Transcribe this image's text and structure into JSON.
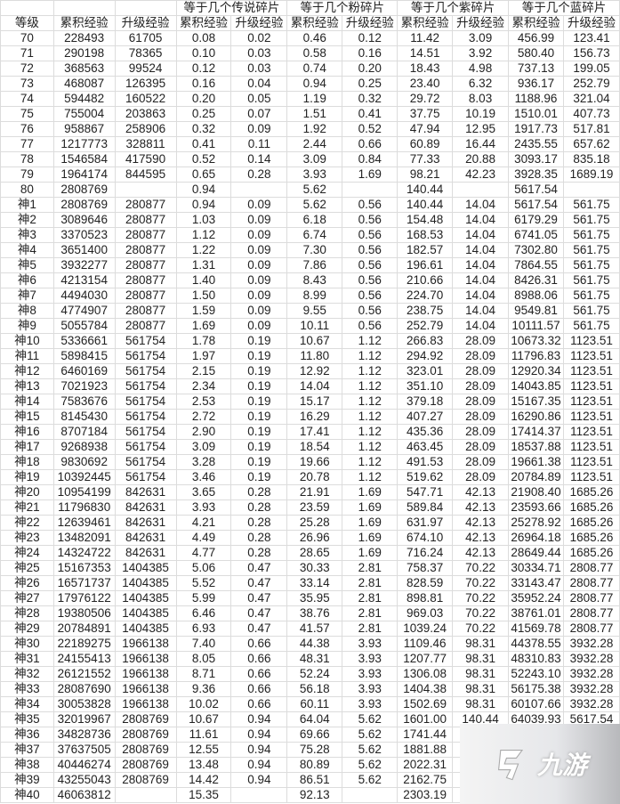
{
  "header": {
    "groups": [
      "等于几个传说碎片",
      "等于几个粉碎片",
      "等于几个紫碎片",
      "等于几个蓝碎片"
    ],
    "columns": [
      "等级",
      "累积经验",
      "升级经验",
      "累积经验",
      "升级经验",
      "累积经验",
      "升级经验",
      "累积经验",
      "升级经验",
      "累积经验",
      "升级经验"
    ]
  },
  "rows": [
    [
      "70",
      "228493",
      "61705",
      "0.08",
      "0.02",
      "0.46",
      "0.12",
      "11.42",
      "3.09",
      "456.99",
      "123.41"
    ],
    [
      "71",
      "290198",
      "78365",
      "0.10",
      "0.03",
      "0.58",
      "0.16",
      "14.51",
      "3.92",
      "580.40",
      "156.73"
    ],
    [
      "72",
      "368563",
      "99524",
      "0.12",
      "0.03",
      "0.74",
      "0.20",
      "18.43",
      "4.98",
      "737.13",
      "199.05"
    ],
    [
      "73",
      "468087",
      "126395",
      "0.16",
      "0.04",
      "0.94",
      "0.25",
      "23.40",
      "6.32",
      "936.17",
      "252.79"
    ],
    [
      "74",
      "594482",
      "160522",
      "0.20",
      "0.05",
      "1.19",
      "0.32",
      "29.72",
      "8.03",
      "1188.96",
      "321.04"
    ],
    [
      "75",
      "755004",
      "203863",
      "0.25",
      "0.07",
      "1.51",
      "0.41",
      "37.75",
      "10.19",
      "1510.01",
      "407.73"
    ],
    [
      "76",
      "958867",
      "258906",
      "0.32",
      "0.09",
      "1.92",
      "0.52",
      "47.94",
      "12.95",
      "1917.73",
      "517.81"
    ],
    [
      "77",
      "1217773",
      "328811",
      "0.41",
      "0.11",
      "2.44",
      "0.66",
      "60.89",
      "16.44",
      "2435.55",
      "657.62"
    ],
    [
      "78",
      "1546584",
      "417590",
      "0.52",
      "0.14",
      "3.09",
      "0.84",
      "77.33",
      "20.88",
      "3093.17",
      "835.18"
    ],
    [
      "79",
      "1964174",
      "844595",
      "0.65",
      "0.28",
      "3.93",
      "1.69",
      "98.21",
      "42.23",
      "3928.35",
      "1689.19"
    ],
    [
      "80",
      "2808769",
      "",
      "0.94",
      "",
      "5.62",
      "",
      "140.44",
      "",
      "5617.54",
      ""
    ],
    [
      "神1",
      "2808769",
      "280877",
      "0.94",
      "0.09",
      "5.62",
      "0.56",
      "140.44",
      "14.04",
      "5617.54",
      "561.75"
    ],
    [
      "神2",
      "3089646",
      "280877",
      "1.03",
      "0.09",
      "6.18",
      "0.56",
      "154.48",
      "14.04",
      "6179.29",
      "561.75"
    ],
    [
      "神3",
      "3370523",
      "280877",
      "1.12",
      "0.09",
      "6.74",
      "0.56",
      "168.53",
      "14.04",
      "6741.05",
      "561.75"
    ],
    [
      "神4",
      "3651400",
      "280877",
      "1.22",
      "0.09",
      "7.30",
      "0.56",
      "182.57",
      "14.04",
      "7302.80",
      "561.75"
    ],
    [
      "神5",
      "3932277",
      "280877",
      "1.31",
      "0.09",
      "7.86",
      "0.56",
      "196.61",
      "14.04",
      "7864.55",
      "561.75"
    ],
    [
      "神6",
      "4213154",
      "280877",
      "1.40",
      "0.09",
      "8.43",
      "0.56",
      "210.66",
      "14.04",
      "8426.31",
      "561.75"
    ],
    [
      "神7",
      "4494030",
      "280877",
      "1.50",
      "0.09",
      "8.99",
      "0.56",
      "224.70",
      "14.04",
      "8988.06",
      "561.75"
    ],
    [
      "神8",
      "4774907",
      "280877",
      "1.59",
      "0.09",
      "9.55",
      "0.56",
      "238.75",
      "14.04",
      "9549.81",
      "561.75"
    ],
    [
      "神9",
      "5055784",
      "280877",
      "1.69",
      "0.09",
      "10.11",
      "0.56",
      "252.79",
      "14.04",
      "10111.57",
      "561.75"
    ],
    [
      "神10",
      "5336661",
      "561754",
      "1.78",
      "0.19",
      "10.67",
      "1.12",
      "266.83",
      "28.09",
      "10673.32",
      "1123.51"
    ],
    [
      "神11",
      "5898415",
      "561754",
      "1.97",
      "0.19",
      "11.80",
      "1.12",
      "294.92",
      "28.09",
      "11796.83",
      "1123.51"
    ],
    [
      "神12",
      "6460169",
      "561754",
      "2.15",
      "0.19",
      "12.92",
      "1.12",
      "323.01",
      "28.09",
      "12920.34",
      "1123.51"
    ],
    [
      "神13",
      "7021923",
      "561754",
      "2.34",
      "0.19",
      "14.04",
      "1.12",
      "351.10",
      "28.09",
      "14043.85",
      "1123.51"
    ],
    [
      "神14",
      "7583676",
      "561754",
      "2.53",
      "0.19",
      "15.17",
      "1.12",
      "379.18",
      "28.09",
      "15167.35",
      "1123.51"
    ],
    [
      "神15",
      "8145430",
      "561754",
      "2.72",
      "0.19",
      "16.29",
      "1.12",
      "407.27",
      "28.09",
      "16290.86",
      "1123.51"
    ],
    [
      "神16",
      "8707184",
      "561754",
      "2.90",
      "0.19",
      "17.41",
      "1.12",
      "435.36",
      "28.09",
      "17414.37",
      "1123.51"
    ],
    [
      "神17",
      "9268938",
      "561754",
      "3.09",
      "0.19",
      "18.54",
      "1.12",
      "463.45",
      "28.09",
      "18537.88",
      "1123.51"
    ],
    [
      "神18",
      "9830692",
      "561754",
      "3.28",
      "0.19",
      "19.66",
      "1.12",
      "491.53",
      "28.09",
      "19661.38",
      "1123.51"
    ],
    [
      "神19",
      "10392445",
      "561754",
      "3.46",
      "0.19",
      "20.78",
      "1.12",
      "519.62",
      "28.09",
      "20784.89",
      "1123.51"
    ],
    [
      "神20",
      "10954199",
      "842631",
      "3.65",
      "0.28",
      "21.91",
      "1.69",
      "547.71",
      "42.13",
      "21908.40",
      "1685.26"
    ],
    [
      "神21",
      "11796830",
      "842631",
      "3.93",
      "0.28",
      "23.59",
      "1.69",
      "589.84",
      "42.13",
      "23593.66",
      "1685.26"
    ],
    [
      "神22",
      "12639461",
      "842631",
      "4.21",
      "0.28",
      "25.28",
      "1.69",
      "631.97",
      "42.13",
      "25278.92",
      "1685.26"
    ],
    [
      "神23",
      "13482091",
      "842631",
      "4.49",
      "0.28",
      "26.96",
      "1.69",
      "674.10",
      "42.13",
      "26964.18",
      "1685.26"
    ],
    [
      "神24",
      "14324722",
      "842631",
      "4.77",
      "0.28",
      "28.65",
      "1.69",
      "716.24",
      "42.13",
      "28649.44",
      "1685.26"
    ],
    [
      "神25",
      "15167353",
      "1404385",
      "5.06",
      "0.47",
      "30.33",
      "2.81",
      "758.37",
      "70.22",
      "30334.71",
      "2808.77"
    ],
    [
      "神26",
      "16571737",
      "1404385",
      "5.52",
      "0.47",
      "33.14",
      "2.81",
      "828.59",
      "70.22",
      "33143.47",
      "2808.77"
    ],
    [
      "神27",
      "17976122",
      "1404385",
      "5.99",
      "0.47",
      "35.95",
      "2.81",
      "898.81",
      "70.22",
      "35952.24",
      "2808.77"
    ],
    [
      "神28",
      "19380506",
      "1404385",
      "6.46",
      "0.47",
      "38.76",
      "2.81",
      "969.03",
      "70.22",
      "38761.01",
      "2808.77"
    ],
    [
      "神29",
      "20784891",
      "1404385",
      "6.93",
      "0.47",
      "41.57",
      "2.81",
      "1039.24",
      "70.22",
      "41569.78",
      "2808.77"
    ],
    [
      "神30",
      "22189275",
      "1966138",
      "7.40",
      "0.66",
      "44.38",
      "3.93",
      "1109.46",
      "98.31",
      "44378.55",
      "3932.28"
    ],
    [
      "神31",
      "24155413",
      "1966138",
      "8.05",
      "0.66",
      "48.31",
      "3.93",
      "1207.77",
      "98.31",
      "48310.83",
      "3932.28"
    ],
    [
      "神32",
      "26121552",
      "1966138",
      "8.71",
      "0.66",
      "52.24",
      "3.93",
      "1306.08",
      "98.31",
      "52243.10",
      "3932.28"
    ],
    [
      "神33",
      "28087690",
      "1966138",
      "9.36",
      "0.66",
      "56.18",
      "3.93",
      "1404.38",
      "98.31",
      "56175.38",
      "3932.28"
    ],
    [
      "神34",
      "30053828",
      "1966138",
      "10.02",
      "0.66",
      "60.11",
      "3.93",
      "1502.69",
      "98.31",
      "60107.66",
      "3932.28"
    ],
    [
      "神35",
      "32019967",
      "2808769",
      "10.67",
      "0.94",
      "64.04",
      "5.62",
      "1601.00",
      "140.44",
      "64039.93",
      "5617.54"
    ],
    [
      "神36",
      "34828736",
      "2808769",
      "11.61",
      "0.94",
      "69.66",
      "5.62",
      "1741.44",
      "",
      "",
      ""
    ],
    [
      "神37",
      "37637505",
      "2808769",
      "12.55",
      "0.94",
      "75.28",
      "5.62",
      "1881.88",
      "",
      "",
      ""
    ],
    [
      "神38",
      "40446274",
      "2808769",
      "13.48",
      "0.94",
      "80.89",
      "5.62",
      "2022.31",
      "",
      "",
      ""
    ],
    [
      "神39",
      "43255043",
      "2808769",
      "14.42",
      "0.94",
      "86.51",
      "5.62",
      "2162.75",
      "",
      "",
      ""
    ],
    [
      "神40",
      "46063812",
      "",
      "15.35",
      "",
      "92.13",
      "",
      "2303.19",
      "",
      "",
      ""
    ]
  ],
  "watermark": {
    "logo_text": "九游",
    "icon": "jiuyou-logo-icon"
  }
}
